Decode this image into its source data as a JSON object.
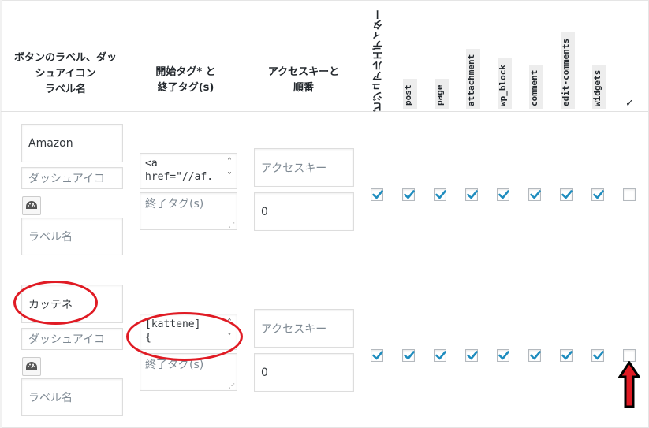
{
  "headers": {
    "label_col": [
      "ボタンのラベル、ダッ",
      "シュアイコン",
      "ラベル名"
    ],
    "tag_col": [
      "開始タグ* と",
      "終了タグ(s)"
    ],
    "access_col": [
      "アクセスキーと",
      "順番"
    ],
    "visual_editor": "ビジュアルエディター",
    "post_types": [
      "post",
      "page",
      "attachment",
      "wp_block",
      "comment",
      "edit-comments",
      "widgets"
    ],
    "check_col": "✓"
  },
  "rows": [
    {
      "button_label": "Amazon",
      "dashicon_placeholder": "ダッシュアイコ",
      "label_name_placeholder": "ラベル名",
      "start_tag": "<a\nhref=\"//af.",
      "end_tag_placeholder": "終了タグ(s)",
      "access_key_placeholder": "アクセスキー",
      "order": "0",
      "checks": [
        true,
        true,
        true,
        true,
        true,
        true,
        true,
        true,
        false
      ]
    },
    {
      "button_label": "カッテネ",
      "dashicon_placeholder": "ダッシュアイコ",
      "label_name_placeholder": "ラベル名",
      "start_tag": "[kattene]\n{",
      "end_tag_placeholder": "終了タグ(s)",
      "access_key_placeholder": "アクセスキー",
      "order": "0",
      "checks": [
        true,
        true,
        true,
        true,
        true,
        true,
        true,
        true,
        false
      ]
    }
  ],
  "colors": {
    "checkmark": "#1e8cbe",
    "annotation_red": "#e01b24"
  }
}
